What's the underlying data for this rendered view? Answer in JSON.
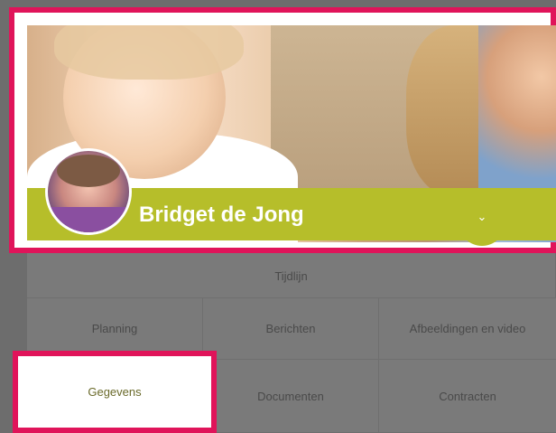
{
  "profile": {
    "name": "Bridget de Jong",
    "expand_icon": "chevron-down-icon",
    "expand_symbol": "⌄"
  },
  "menu": {
    "timeline": "Tijdlijn",
    "planning": "Planning",
    "berichten": "Berichten",
    "media": "Afbeeldingen en video",
    "gegevens": "Gegevens",
    "documenten": "Documenten",
    "contracten": "Contracten"
  },
  "colors": {
    "highlight": "#e0145a",
    "accent": "#b6be2a",
    "overlay": "#6d6d6d"
  }
}
